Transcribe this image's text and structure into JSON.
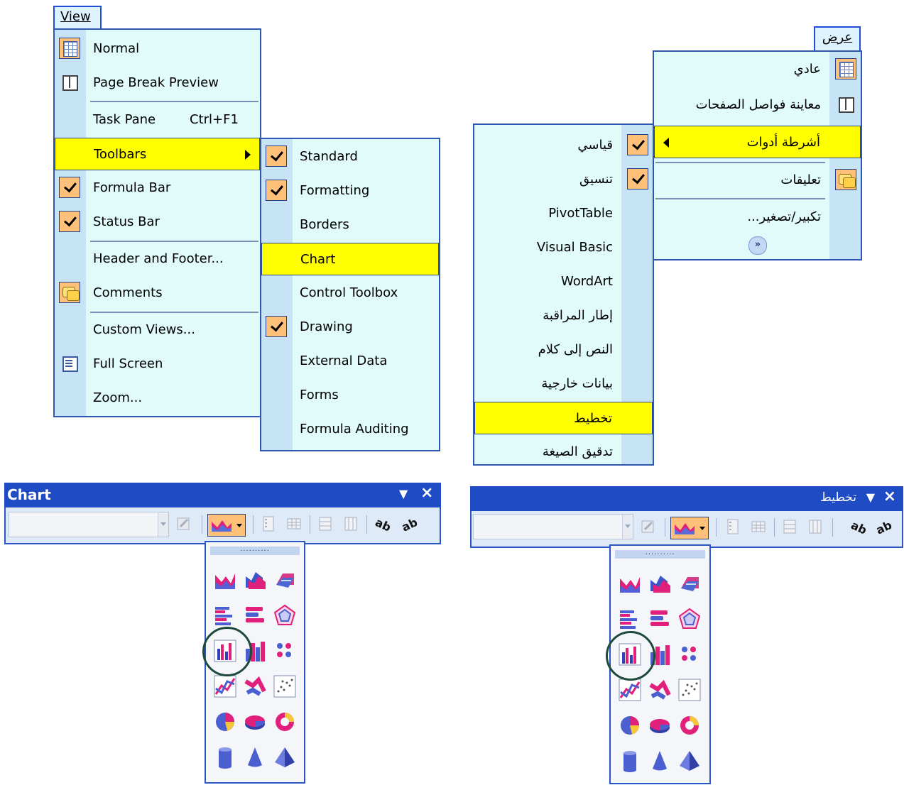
{
  "en_menu": {
    "tab": "View",
    "items": [
      {
        "label": "Normal",
        "icon": "normal-view-icon"
      },
      {
        "label": "Page Break Preview",
        "icon": "page-break-preview-icon"
      },
      {
        "label": "Task Pane",
        "shortcut": "Ctrl+F1"
      },
      {
        "label": "Toolbars",
        "submenu": true,
        "highlighted": true
      },
      {
        "label": "Formula Bar",
        "checked": true
      },
      {
        "label": "Status Bar",
        "checked": true
      },
      {
        "label": "Header and Footer..."
      },
      {
        "label": "Comments",
        "icon": "comments-icon"
      },
      {
        "label": "Custom Views..."
      },
      {
        "label": "Full Screen",
        "icon": "full-screen-icon"
      },
      {
        "label": "Zoom..."
      }
    ]
  },
  "en_submenu": {
    "items": [
      {
        "label": "Standard",
        "checked": true
      },
      {
        "label": "Formatting",
        "checked": true
      },
      {
        "label": "Borders"
      },
      {
        "label": "Chart",
        "highlighted": true
      },
      {
        "label": "Control Toolbox"
      },
      {
        "label": "Drawing",
        "checked": true
      },
      {
        "label": "External Data"
      },
      {
        "label": "Forms"
      },
      {
        "label": "Formula Auditing"
      }
    ]
  },
  "ar_menu": {
    "tab": "عرض",
    "items": [
      {
        "label": "عادي",
        "icon": "normal-view-icon"
      },
      {
        "label": "معاينة فواصل الصفحات",
        "icon": "page-break-preview-icon"
      },
      {
        "label": "أشرطة أدوات",
        "submenu": true,
        "highlighted": true
      },
      {
        "label": "تعليقات",
        "icon": "comments-icon"
      },
      {
        "label": "تكبير/تصغير..."
      }
    ]
  },
  "ar_submenu": {
    "items": [
      {
        "label": "قياسي",
        "checked": true
      },
      {
        "label": "تنسيق",
        "checked": true
      },
      {
        "label": "PivotTable"
      },
      {
        "label": "Visual Basic"
      },
      {
        "label": "WordArt"
      },
      {
        "label": "إطار المراقبة"
      },
      {
        "label": "النص إلى كلام"
      },
      {
        "label": "بيانات خارجية"
      },
      {
        "label": "تخطيط",
        "highlighted": true
      },
      {
        "label": "تدقيق الصيغة"
      }
    ]
  },
  "en_toolbar": {
    "title": "Chart",
    "close_glyph": "×",
    "options_glyph": "▼"
  },
  "ar_toolbar": {
    "title": "تخطيط",
    "close_glyph": "×",
    "options_glyph": "▼"
  },
  "palette_grip": "..........",
  "palette_icons": [
    "area-chart-icon",
    "3d-area-chart-icon",
    "3d-surface-chart-icon",
    "bar-chart-icon",
    "3d-bar-chart-icon",
    "radar-chart-icon",
    "column-chart-icon",
    "3d-column-chart-icon",
    "scatter-dots-icon",
    "line-chart-icon",
    "3d-line-chart-icon",
    "xy-scatter-chart-icon",
    "pie-chart-icon",
    "3d-pie-chart-icon",
    "doughnut-chart-icon",
    "cylinder-chart-icon",
    "cone-chart-icon",
    "pyramid-chart-icon"
  ],
  "colors": {
    "highlight": "#ffff00",
    "menu_bg": "#e1fbfb",
    "check_bg": "#ffc07a",
    "toolbar_title": "#1f4cc4"
  }
}
